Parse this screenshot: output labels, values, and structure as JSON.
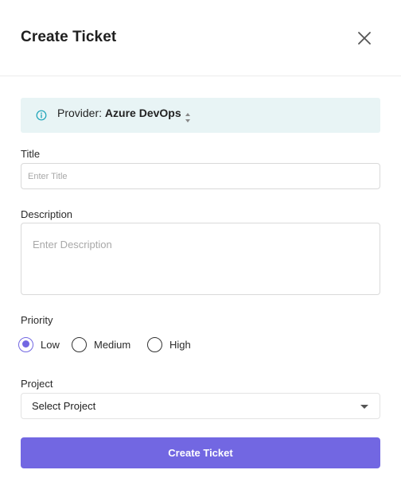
{
  "modal": {
    "title": "Create Ticket",
    "close_icon": "close-icon"
  },
  "banner": {
    "icon": "info-icon",
    "provider_label": "Provider:",
    "provider_value": "Azure DevOps",
    "spinner_icon": "up-down-spinner-icon",
    "accent": "#e8f4f5",
    "icon_color": "#1aa3b8"
  },
  "form": {
    "title": {
      "label": "Title",
      "placeholder": "Enter Title",
      "value": ""
    },
    "description": {
      "label": "Description",
      "placeholder": "Enter Description",
      "value": ""
    },
    "priority": {
      "label": "Priority",
      "selected": "Low",
      "options": [
        "Low",
        "Medium",
        "High"
      ]
    },
    "project": {
      "label": "Project",
      "selected": "Select Project"
    },
    "submit_label": "Create Ticket"
  },
  "colors": {
    "primary": "#7267e2",
    "border": "#d9d9d9",
    "text": "#1f1f1f"
  }
}
